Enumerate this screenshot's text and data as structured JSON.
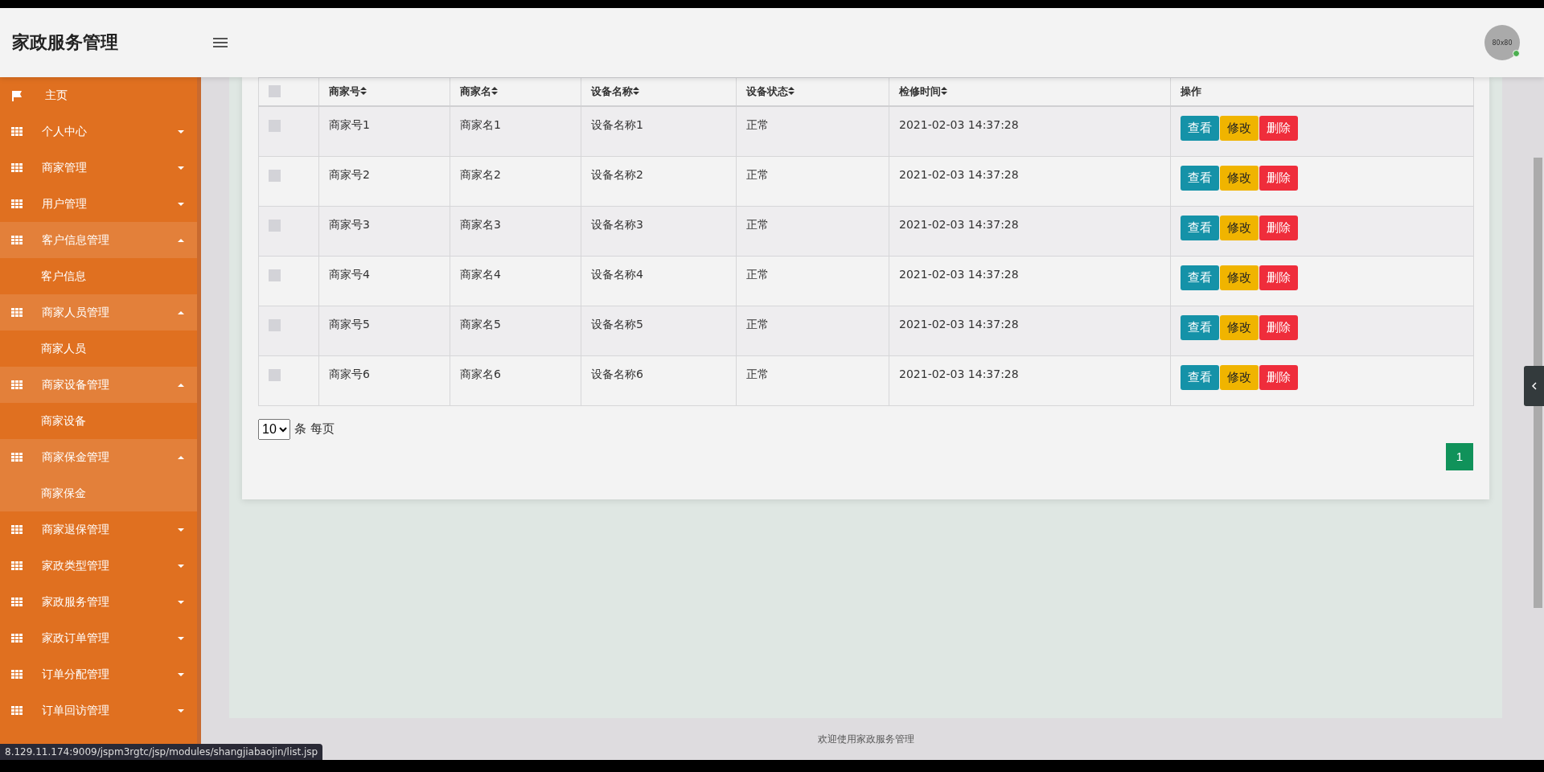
{
  "header": {
    "title": "家政服务管理",
    "avatar": "80x80",
    "online": true
  },
  "sidebar": {
    "items": [
      {
        "label": "主页",
        "kind": "home",
        "expanded": false
      },
      {
        "label": "个人中心",
        "kind": "group",
        "expanded": false
      },
      {
        "label": "商家管理",
        "kind": "group",
        "expanded": false
      },
      {
        "label": "用户管理",
        "kind": "group",
        "expanded": false
      },
      {
        "label": "客户信息管理",
        "kind": "group",
        "expanded": true,
        "children": [
          {
            "label": "客户信息",
            "selected": false
          }
        ]
      },
      {
        "label": "商家人员管理",
        "kind": "group",
        "expanded": true,
        "children": [
          {
            "label": "商家人员",
            "selected": false
          }
        ]
      },
      {
        "label": "商家设备管理",
        "kind": "group",
        "expanded": true,
        "children": [
          {
            "label": "商家设备",
            "selected": false
          }
        ]
      },
      {
        "label": "商家保金管理",
        "kind": "group",
        "expanded": true,
        "children": [
          {
            "label": "商家保金",
            "selected": true
          }
        ]
      },
      {
        "label": "商家退保管理",
        "kind": "group",
        "expanded": false
      },
      {
        "label": "家政类型管理",
        "kind": "group",
        "expanded": false
      },
      {
        "label": "家政服务管理",
        "kind": "group",
        "expanded": false
      },
      {
        "label": "家政订单管理",
        "kind": "group",
        "expanded": false
      },
      {
        "label": "订单分配管理",
        "kind": "group",
        "expanded": false
      },
      {
        "label": "订单回访管理",
        "kind": "group",
        "expanded": false
      }
    ]
  },
  "table": {
    "header_checked": false,
    "columns": [
      {
        "label": "商家号",
        "sortable": true
      },
      {
        "label": "商家名",
        "sortable": true
      },
      {
        "label": "设备名称",
        "sortable": true
      },
      {
        "label": "设备状态",
        "sortable": true
      },
      {
        "label": "检修时间",
        "sortable": true
      },
      {
        "label": "操作",
        "sortable": false
      }
    ],
    "rows": [
      {
        "checked": false,
        "cells": [
          "商家号1",
          "商家名1",
          "设备名称1",
          "正常",
          "2021-02-03 14:37:28"
        ],
        "actions": [
          {
            "label": "查看",
            "kind": "view"
          },
          {
            "label": "修改",
            "kind": "edit"
          },
          {
            "label": "删除",
            "kind": "delete"
          }
        ]
      },
      {
        "checked": false,
        "cells": [
          "商家号2",
          "商家名2",
          "设备名称2",
          "正常",
          "2021-02-03 14:37:28"
        ],
        "actions": [
          {
            "label": "查看",
            "kind": "view"
          },
          {
            "label": "修改",
            "kind": "edit"
          },
          {
            "label": "删除",
            "kind": "delete"
          }
        ]
      },
      {
        "checked": false,
        "cells": [
          "商家号3",
          "商家名3",
          "设备名称3",
          "正常",
          "2021-02-03 14:37:28"
        ],
        "actions": [
          {
            "label": "查看",
            "kind": "view"
          },
          {
            "label": "修改",
            "kind": "edit"
          },
          {
            "label": "删除",
            "kind": "delete"
          }
        ]
      },
      {
        "checked": false,
        "cells": [
          "商家号4",
          "商家名4",
          "设备名称4",
          "正常",
          "2021-02-03 14:37:28"
        ],
        "actions": [
          {
            "label": "查看",
            "kind": "view"
          },
          {
            "label": "修改",
            "kind": "edit"
          },
          {
            "label": "删除",
            "kind": "delete"
          }
        ]
      },
      {
        "checked": false,
        "cells": [
          "商家号5",
          "商家名5",
          "设备名称5",
          "正常",
          "2021-02-03 14:37:28"
        ],
        "actions": [
          {
            "label": "查看",
            "kind": "view"
          },
          {
            "label": "修改",
            "kind": "edit"
          },
          {
            "label": "删除",
            "kind": "delete"
          }
        ]
      },
      {
        "checked": false,
        "cells": [
          "商家号6",
          "商家名6",
          "设备名称6",
          "正常",
          "2021-02-03 14:37:28"
        ],
        "actions": [
          {
            "label": "查看",
            "kind": "view"
          },
          {
            "label": "修改",
            "kind": "edit"
          },
          {
            "label": "删除",
            "kind": "delete"
          }
        ]
      }
    ]
  },
  "pagination": {
    "page_size": "10",
    "page_size_label": "条 每页",
    "pages": [
      {
        "label": "1",
        "selected": true
      }
    ]
  },
  "footer": {
    "text": "欢迎使用家政服务管理"
  },
  "status_url": "8.129.11.174:9009/jspm3rgtc/jsp/modules/shangjiabaojin/list.jsp"
}
